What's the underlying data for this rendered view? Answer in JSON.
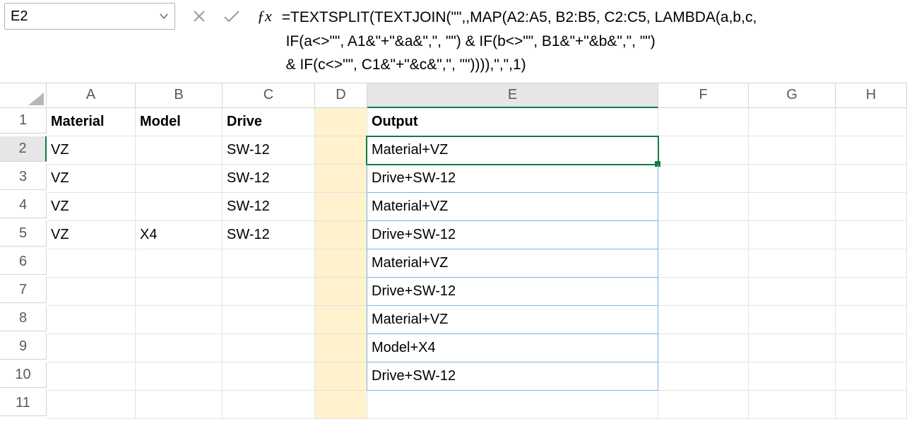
{
  "namebox": {
    "value": "E2"
  },
  "formula_lines": [
    "=TEXTSPLIT(TEXTJOIN(\"\",,MAP(A2:A5, B2:B5, C2:C5, LAMBDA(a,b,c,",
    " IF(a<>\"\", A1&\"+\"&a&\",\", \"\") & IF(b<>\"\", B1&\"+\"&b&\",\", \"\")",
    " & IF(c<>\"\", C1&\"+\"&c&\",\", \"\")))),\",\",1)"
  ],
  "columns": [
    "A",
    "B",
    "C",
    "D",
    "E",
    "F",
    "G",
    "H"
  ],
  "rows": [
    "1",
    "2",
    "3",
    "4",
    "5",
    "6",
    "7",
    "8",
    "9",
    "10",
    "11"
  ],
  "data": {
    "A1": "Material",
    "B1": "Model",
    "C1": "Drive",
    "E1": "Output",
    "A2": "VZ",
    "C2": "SW-12",
    "E2": "Material+VZ",
    "A3": "VZ",
    "C3": "SW-12",
    "E3": "Drive+SW-12",
    "A4": "VZ",
    "C4": "SW-12",
    "E4": "Material+VZ",
    "A5": "VZ",
    "B5": "X4",
    "C5": "SW-12",
    "E5": "Drive+SW-12",
    "E6": "Material+VZ",
    "E7": "Drive+SW-12",
    "E8": "Material+VZ",
    "E9": "Model+X4",
    "E10": "Drive+SW-12"
  },
  "bold_cells": [
    "A1",
    "B1",
    "C1",
    "E1"
  ],
  "highlight_col": "D",
  "active_cell": "E2",
  "spill_range": [
    "E2",
    "E3",
    "E4",
    "E5",
    "E6",
    "E7",
    "E8",
    "E9",
    "E10"
  ],
  "selected_col": "E",
  "selected_row": "2"
}
